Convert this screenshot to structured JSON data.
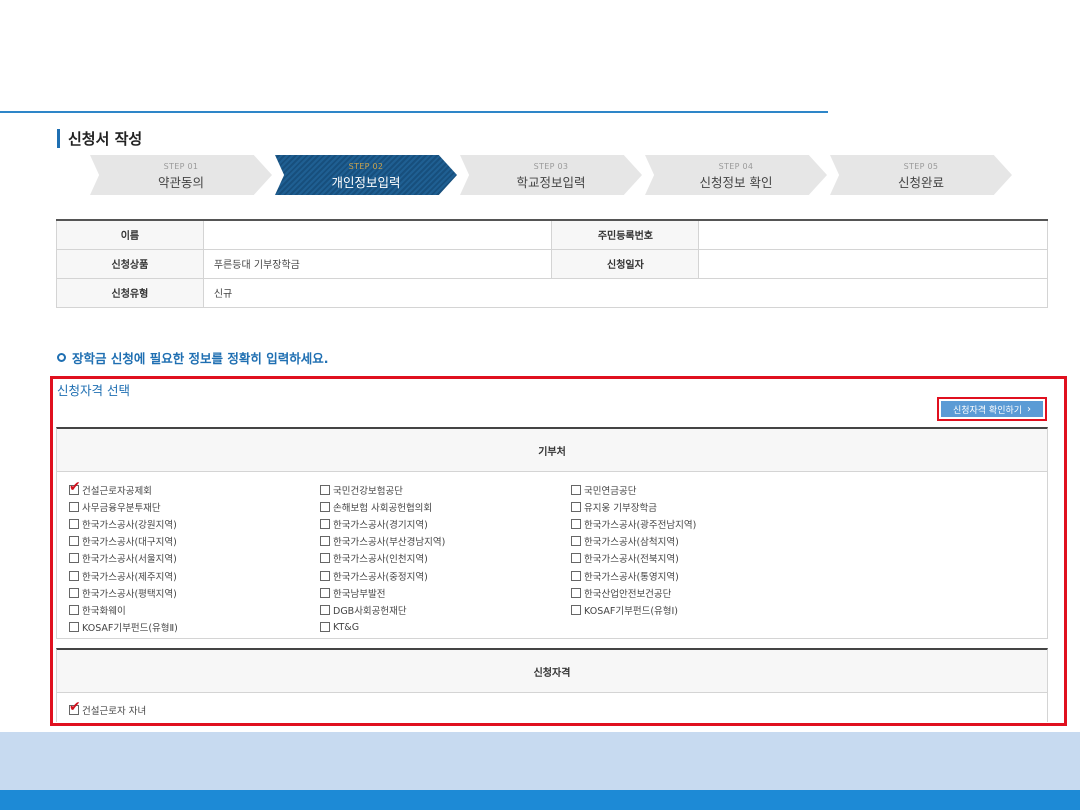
{
  "page": {
    "section_title": "신청서 작성",
    "guide_text": "장학금 신청에 필요한 정보를 정확히 입력하세요.",
    "qualification_title": "신청자격 선택",
    "check_button_label": "신청자격 확인하기"
  },
  "steps": [
    {
      "num": "STEP 01",
      "label": "약관동의"
    },
    {
      "num": "STEP 02",
      "label": "개인정보입력"
    },
    {
      "num": "STEP 03",
      "label": "학교정보입력"
    },
    {
      "num": "STEP 04",
      "label": "신청정보 확인"
    },
    {
      "num": "STEP 05",
      "label": "신청완료"
    }
  ],
  "active_step": 2,
  "info": {
    "name_label": "이름",
    "name_value": "",
    "ssn_label": "주민등록번호",
    "ssn_value": "",
    "product_label": "신청상품",
    "product_value": "푸른등대 기부장학금",
    "date_label": "신청일자",
    "date_value": "",
    "type_label": "신청유형",
    "type_value": "신규"
  },
  "donors_header": "기부처",
  "donors": [
    {
      "label": "건설근로자공제회",
      "checked": true
    },
    {
      "label": "국민건강보험공단",
      "checked": false
    },
    {
      "label": "국민연금공단",
      "checked": false
    },
    {
      "label": "사무금융우분투재단",
      "checked": false
    },
    {
      "label": "손해보험 사회공헌협의회",
      "checked": false
    },
    {
      "label": "유지웅 기부장학금",
      "checked": false
    },
    {
      "label": "한국가스공사(강원지역)",
      "checked": false
    },
    {
      "label": "한국가스공사(경기지역)",
      "checked": false
    },
    {
      "label": "한국가스공사(광주전남지역)",
      "checked": false
    },
    {
      "label": "한국가스공사(대구지역)",
      "checked": false
    },
    {
      "label": "한국가스공사(부산경남지역)",
      "checked": false
    },
    {
      "label": "한국가스공사(삼척지역)",
      "checked": false
    },
    {
      "label": "한국가스공사(서울지역)",
      "checked": false
    },
    {
      "label": "한국가스공사(인천지역)",
      "checked": false
    },
    {
      "label": "한국가스공사(전북지역)",
      "checked": false
    },
    {
      "label": "한국가스공사(제주지역)",
      "checked": false
    },
    {
      "label": "한국가스공사(중정지역)",
      "checked": false
    },
    {
      "label": "한국가스공사(통영지역)",
      "checked": false
    },
    {
      "label": "한국가스공사(평택지역)",
      "checked": false
    },
    {
      "label": "한국남부발전",
      "checked": false
    },
    {
      "label": "한국산업안전보건공단",
      "checked": false
    },
    {
      "label": "한국화웨이",
      "checked": false
    },
    {
      "label": "DGB사회공헌재단",
      "checked": false
    },
    {
      "label": "KOSAF기부펀드(유형Ⅰ)",
      "checked": false
    },
    {
      "label": "KOSAF기부펀드(유형Ⅱ)",
      "checked": false
    },
    {
      "label": "KT&G",
      "checked": false
    }
  ],
  "qualification_header": "신청자격",
  "qualification_item": {
    "label": "건설근로자 자녀",
    "checked": true
  },
  "colors": {
    "accent": "#1f6fb2",
    "highlight_border": "#e0101f",
    "check_mark": "#d0101c",
    "footer": "#1d8ad6"
  }
}
